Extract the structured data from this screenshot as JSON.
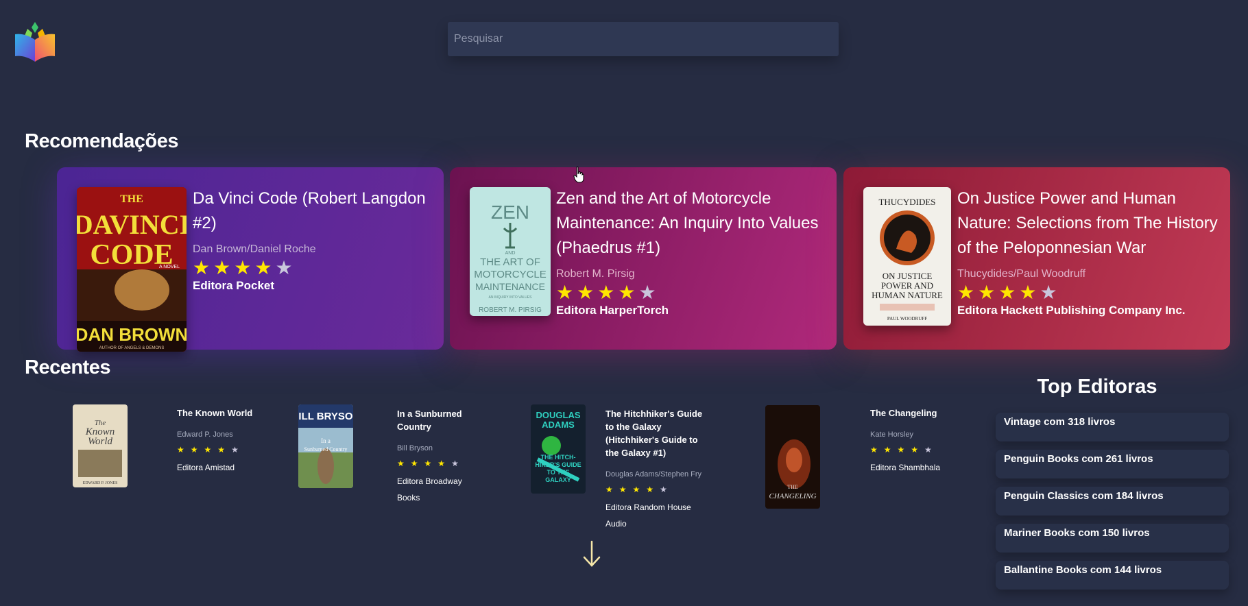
{
  "search": {
    "placeholder": "Pesquisar"
  },
  "logo_icon": "open-book-logo-icon",
  "recommendations": {
    "title": "Recomendações",
    "cards": [
      {
        "title": "Da Vinci Code (Robert Langdon #2)",
        "author": "Dan Brown/Daniel Roche",
        "rating": 4,
        "publisher": "Editora Pocket",
        "cover": {
          "line1": "THE",
          "line2": "DAVINCI",
          "line3": "CODE",
          "tag": "A NOVEL",
          "author": "DAN BROWN",
          "sub": "AUTHOR OF ANGELS & DEMONS"
        }
      },
      {
        "title": "Zen and the Art of Motorcycle Maintenance: An Inquiry Into Values (Phaedrus #1)",
        "author": "Robert M. Pirsig",
        "rating": 4,
        "publisher": "Editora HarperTorch",
        "cover": {
          "line1": "ZEN",
          "line2": "AND",
          "line3": "THE ART OF",
          "line4": "MOTORCYCLE",
          "line5": "MAINTENANCE",
          "sub": "AN INQUIRY INTO VALUES",
          "author": "ROBERT M. PIRSIG"
        }
      },
      {
        "title": "On Justice Power and Human Nature: Selections from The History of the Peloponnesian War",
        "author": "Thucydides/Paul Woodruff",
        "rating": 4,
        "publisher": "Editora Hackett Publishing Company Inc.",
        "cover": {
          "top": "THUCYDIDES",
          "line1": "ON JUSTICE",
          "line2": "POWER AND",
          "line3": "HUMAN NATURE",
          "author": "PAUL WOODRUFF"
        }
      }
    ]
  },
  "recent": {
    "title": "Recentes",
    "items": [
      {
        "title": "The Known World",
        "author": "Edward P. Jones",
        "rating": 4,
        "publisher": "Editora Amistad",
        "cover": {
          "line1": "The",
          "line2": "Known",
          "line3": "World",
          "author": "EDWARD P. JONES"
        }
      },
      {
        "title": "In a Sunburned Country",
        "author": "Bill Bryson",
        "rating": 4,
        "publisher": "Editora Broadway Books",
        "cover": {
          "line1": "BILL BRYSON",
          "line2": "In a",
          "line3": "Sunburned Country"
        }
      },
      {
        "title": "The Hitchhiker's Guide to the Galaxy (Hitchhiker's Guide to the Galaxy #1)",
        "author": "Douglas Adams/Stephen Fry",
        "rating": 4,
        "publisher": "Editora Random House Audio",
        "cover": {
          "line1": "DOUGLAS",
          "line2": "ADAMS",
          "line3": "THE HITCH-HIKER'S GUIDE TO THE GALAXY"
        }
      },
      {
        "title": "The Changeling",
        "author": "Kate Horsley",
        "rating": 4,
        "publisher": "Editora Shambhala",
        "cover": {
          "line1": "THE",
          "line2": "CHANGELING"
        }
      }
    ],
    "more_icon": "arrow-down-icon"
  },
  "top_publishers": {
    "title": "Top Editoras",
    "items": [
      "Vintage com 318 livros",
      "Penguin Books com 261 livros",
      "Penguin Classics com 184 livros",
      "Mariner Books com 150 livros",
      "Ballantine Books com 144 livros"
    ]
  },
  "colors": {
    "background": "#262c42",
    "star_on": "#ffe600",
    "star_off": "#c9c6dc",
    "card1": "#5b2797",
    "card2": "#9a2371",
    "card3": "#a8283f"
  }
}
